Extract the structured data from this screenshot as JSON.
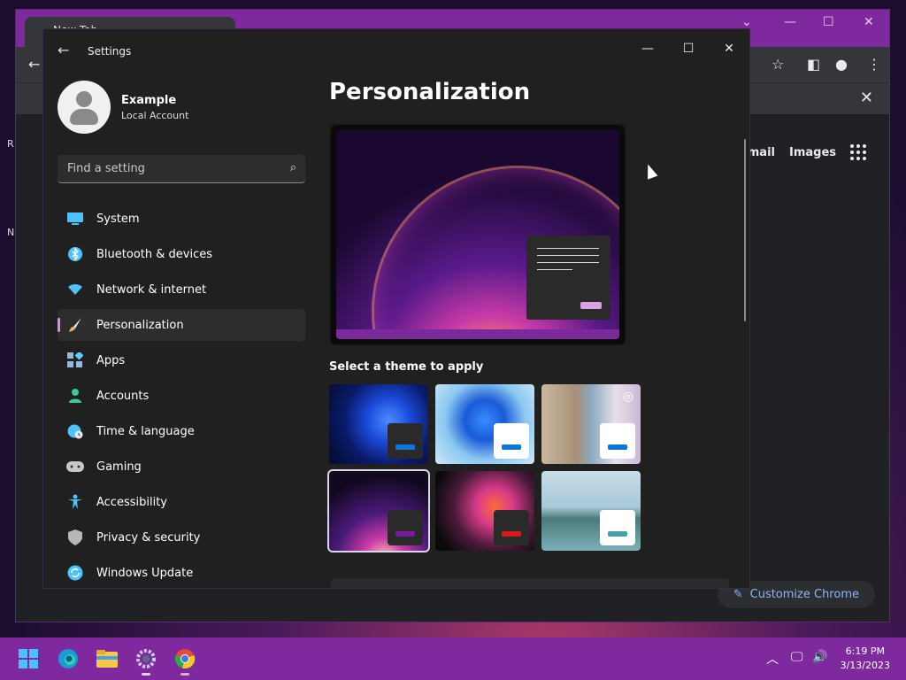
{
  "desktop": {
    "hint_r": "R",
    "hint_n": "N"
  },
  "chrome": {
    "tab_title": "New Tab",
    "links": [
      "Gmail",
      "Images"
    ],
    "customize_label": "Customize Chrome",
    "close_symbol": "✕",
    "icons": [
      "star-icon",
      "side-panel-icon",
      "profile-icon",
      "menu-icon"
    ]
  },
  "settings": {
    "app_title": "Settings",
    "window_controls": [
      "minimize-icon",
      "maximize-icon",
      "close-icon"
    ],
    "profile": {
      "name": "Example",
      "account_type": "Local Account"
    },
    "search": {
      "placeholder": "Find a setting"
    },
    "nav": [
      {
        "label": "System",
        "icon": "monitor-icon",
        "color": "#4cc2ff"
      },
      {
        "label": "Bluetooth & devices",
        "icon": "bluetooth-icon",
        "color": "#4cc2ff"
      },
      {
        "label": "Network & internet",
        "icon": "wifi-icon",
        "color": "#4cc2ff"
      },
      {
        "label": "Personalization",
        "icon": "paintbrush-icon",
        "color": "#f0b070",
        "active": true
      },
      {
        "label": "Apps",
        "icon": "apps-icon",
        "color": "#9ab8d8"
      },
      {
        "label": "Accounts",
        "icon": "person-icon",
        "color": "#3ac8a0"
      },
      {
        "label": "Time & language",
        "icon": "globe-clock-icon",
        "color": "#4cc2ff"
      },
      {
        "label": "Gaming",
        "icon": "controller-icon",
        "color": "#c8c8c8"
      },
      {
        "label": "Accessibility",
        "icon": "accessibility-icon",
        "color": "#4cc2ff"
      },
      {
        "label": "Privacy & security",
        "icon": "shield-icon",
        "color": "#b8b8b8"
      },
      {
        "label": "Windows Update",
        "icon": "refresh-icon",
        "color": "#4cc2ff"
      }
    ],
    "page_title": "Personalization",
    "theme_section_label": "Select a theme to apply",
    "themes": [
      {
        "name": "windows-dark",
        "accent": "#0a78d8",
        "mini_bg": "#2a2a2a"
      },
      {
        "name": "windows-light",
        "accent": "#0a78d8",
        "mini_bg": "#ffffff"
      },
      {
        "name": "windows-spotlight",
        "accent": "#0a78d8",
        "mini_bg": "#ffffff"
      },
      {
        "name": "glow",
        "accent": "#7a1a9a",
        "mini_bg": "#2a2a2a",
        "selected": true
      },
      {
        "name": "captured-motion",
        "accent": "#d81a1a",
        "mini_bg": "#2a2a2a"
      },
      {
        "name": "flow",
        "accent": "#4aa0a8",
        "mini_bg": "#ffffff"
      }
    ]
  },
  "taskbar": {
    "apps": [
      "start-icon",
      "edge-icon",
      "file-explorer-icon",
      "settings-icon",
      "chrome-icon"
    ],
    "time": "6:19 PM",
    "date": "3/13/2023"
  }
}
